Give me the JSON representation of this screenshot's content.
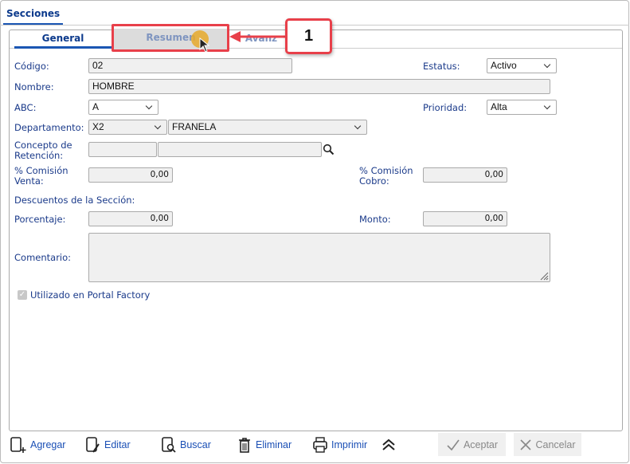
{
  "top_tab": "Secciones",
  "tabs": [
    {
      "label": "General"
    },
    {
      "label": "Resumen"
    },
    {
      "label": "Avanz"
    }
  ],
  "callout": "1",
  "form": {
    "codigo": {
      "label": "Código:",
      "value": "02"
    },
    "estatus": {
      "label": "Estatus:",
      "value": "Activo"
    },
    "nombre": {
      "label": "Nombre:",
      "value": "HOMBRE"
    },
    "abc": {
      "label": "ABC:",
      "value": "A"
    },
    "prioridad": {
      "label": "Prioridad:",
      "value": "Alta"
    },
    "departamento": {
      "label": "Departamento:",
      "code": "X2",
      "name": "FRANELA"
    },
    "concepto": {
      "label1": "Concepto de",
      "label2": "Retención:",
      "code": "",
      "name": ""
    },
    "comision_venta": {
      "label1": "% Comisión",
      "label2": "Venta:",
      "value": "0,00"
    },
    "comision_cobro": {
      "label1": "% Comisión",
      "label2": "Cobro:",
      "value": "0,00"
    },
    "descuentos_heading": "Descuentos de la Sección:",
    "porcentaje": {
      "label": "Porcentaje:",
      "value": "0,00"
    },
    "monto": {
      "label": "Monto:",
      "value": "0,00"
    },
    "comentario": {
      "label": "Comentario:",
      "value": ""
    },
    "portal_factory": {
      "label": "Utilizado en Portal Factory",
      "checked": true
    }
  },
  "toolbar": {
    "agregar": "Agregar",
    "editar": "Editar",
    "buscar": "Buscar",
    "eliminar": "Eliminar",
    "imprimir": "Imprimir",
    "aceptar": "Aceptar",
    "cancelar": "Cancelar"
  },
  "colors": {
    "accent": "#1b56b3",
    "annotation": "#e8404a",
    "cursor_dot": "#e6a92a"
  }
}
